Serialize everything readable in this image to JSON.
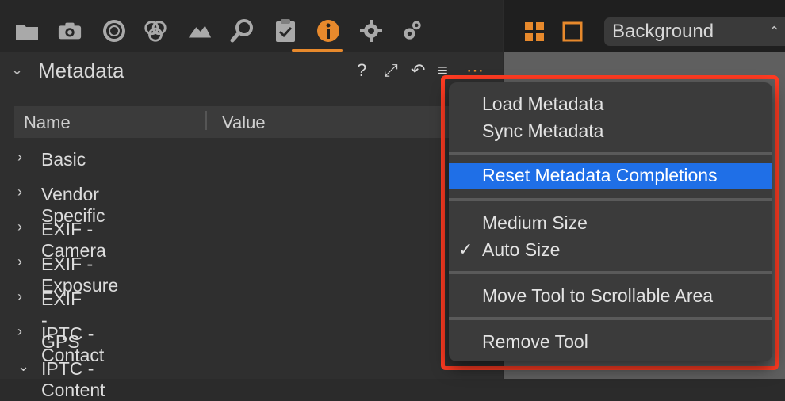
{
  "toolbar": {
    "icons": [
      "folder-icon",
      "camera-icon",
      "circle-icon",
      "overlapping-circles-icon",
      "landscape-icon",
      "search-icon",
      "clipboard-check-icon",
      "info-icon",
      "gear-icon",
      "gears-icon"
    ]
  },
  "right_toolbar": {
    "background_select": "Background"
  },
  "panel": {
    "title": "Metadata",
    "columns": {
      "name": "Name",
      "value": "Value"
    },
    "rows": [
      {
        "label": "Basic",
        "expanded": false
      },
      {
        "label": "Vendor Specific",
        "expanded": false
      },
      {
        "label": "EXIF - Camera",
        "expanded": false
      },
      {
        "label": "EXIF - Exposure",
        "expanded": false
      },
      {
        "label": "EXIF - GPS",
        "expanded": false
      },
      {
        "label": "IPTC - Contact",
        "expanded": false
      },
      {
        "label": "IPTC - Content",
        "expanded": true
      }
    ]
  },
  "menu": {
    "items": [
      {
        "label": "Load Metadata"
      },
      {
        "label": "Sync Metadata"
      },
      {
        "label": "Reset Metadata Completions",
        "selected": true
      },
      {
        "label": "Medium Size"
      },
      {
        "label": "Auto Size",
        "checked": true
      },
      {
        "label": "Move Tool to Scrollable Area"
      },
      {
        "label": "Remove Tool"
      }
    ]
  },
  "colors": {
    "accent": "#e7892c",
    "highlight": "#ff3b22",
    "selection": "#1f6fe7"
  }
}
